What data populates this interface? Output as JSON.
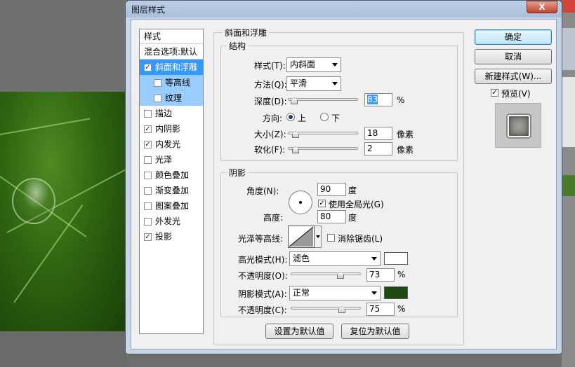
{
  "window": {
    "title": "图层样式",
    "close_label": "X"
  },
  "styles": {
    "header": "样式",
    "blend_options": "混合选项:默认",
    "items": [
      {
        "label": "斜面和浮雕",
        "checked": true,
        "check": "✓"
      },
      {
        "label": "等高线",
        "checked": false,
        "check": ""
      },
      {
        "label": "纹理",
        "checked": false,
        "check": ""
      },
      {
        "label": "描边",
        "checked": false,
        "check": ""
      },
      {
        "label": "内阴影",
        "checked": true,
        "check": "✓"
      },
      {
        "label": "内发光",
        "checked": true,
        "check": "✓"
      },
      {
        "label": "光泽",
        "checked": false,
        "check": ""
      },
      {
        "label": "颜色叠加",
        "checked": false,
        "check": ""
      },
      {
        "label": "渐变叠加",
        "checked": false,
        "check": ""
      },
      {
        "label": "图案叠加",
        "checked": false,
        "check": ""
      },
      {
        "label": "外发光",
        "checked": false,
        "check": ""
      },
      {
        "label": "投影",
        "checked": true,
        "check": "✓"
      }
    ]
  },
  "bevel": {
    "title": "斜面和浮雕",
    "structure": {
      "title": "结构",
      "style_label": "样式(T):",
      "style_value": "内斜面",
      "technique_label": "方法(Q):",
      "technique_value": "平滑",
      "depth_label": "深度(D):",
      "depth_value": "83",
      "depth_unit": "%",
      "direction_label": "方向:",
      "direction_up": "上",
      "direction_down": "下",
      "direction_selected": "上",
      "size_label": "大小(Z):",
      "size_value": "18",
      "size_unit": "像素",
      "soften_label": "软化(F):",
      "soften_value": "2",
      "soften_unit": "像素",
      "depth_slider_fraction": 0.04,
      "size_slider_fraction": 0.07,
      "soften_slider_fraction": 0.07
    },
    "shading": {
      "title": "阴影",
      "angle_label": "角度(N):",
      "angle_value": "90",
      "angle_unit": "度",
      "global_light_label": "使用全局光(G)",
      "global_light_checked": true,
      "global_light_check": "✓",
      "altitude_label": "高度:",
      "altitude_value": "80",
      "altitude_unit": "度",
      "gloss_contour_label": "光泽等高线:",
      "antialias_label": "消除锯齿(L)",
      "antialias_checked": false,
      "antialias_check": "",
      "highlight_mode_label": "高光模式(H):",
      "highlight_mode_value": "滤色",
      "highlight_color": "#ffffff",
      "highlight_opacity_label": "不透明度(O):",
      "highlight_opacity_value": "73",
      "highlight_opacity_unit": "%",
      "shadow_mode_label": "阴影模式(A):",
      "shadow_mode_value": "正常",
      "shadow_color": "#1c4a12",
      "shadow_opacity_label": "不透明度(C):",
      "shadow_opacity_value": "75",
      "shadow_opacity_unit": "%",
      "highlight_opacity_fraction": 0.73,
      "shadow_opacity_fraction": 0.75
    },
    "make_default": "设置为默认值",
    "reset_default": "复位为默认值"
  },
  "actions": {
    "ok": "确定",
    "cancel": "取消",
    "new_style": "新建样式(W)...",
    "preview_label": "预览(V)",
    "preview_checked": true,
    "preview_check": "✓"
  }
}
